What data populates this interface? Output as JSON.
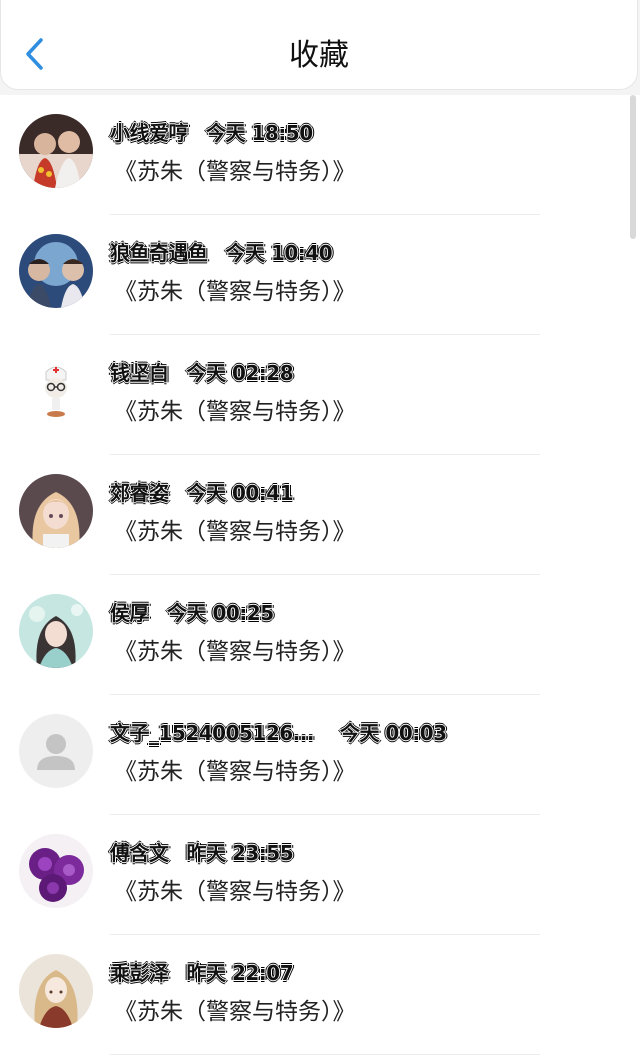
{
  "header": {
    "title": "收藏",
    "back_icon": "chevron-left-icon",
    "accent_color": "#2f8ee0"
  },
  "favorites": [
    {
      "user": "小线爱哼",
      "time": "今天 18:50",
      "book": "《苏朱（警察与特务）》",
      "avatar": "photo-avatar"
    },
    {
      "user": "狼鱼奇遇鱼",
      "time": "今天 10:40",
      "book": "《苏朱（警察与特务）》",
      "avatar": "photo-avatar"
    },
    {
      "user": "钱坚白",
      "time": "今天 02:28",
      "book": "《苏朱（警察与特务）》",
      "avatar": "doctor-bust-avatar"
    },
    {
      "user": "郊睿姿",
      "time": "今天 00:41",
      "book": "《苏朱（警察与特务）》",
      "avatar": "anime-avatar"
    },
    {
      "user": "侯厚",
      "time": "今天 00:25",
      "book": "《苏朱（警察与特务）》",
      "avatar": "photo-avatar"
    },
    {
      "user": "文子_1524005126...",
      "time": "今天 00:03",
      "book": "《苏朱（警察与特务）》",
      "avatar": "default-user-icon"
    },
    {
      "user": "傅含文",
      "time": "昨天 23:55",
      "book": "《苏朱（警察与特务）》",
      "avatar": "purple-roses-avatar"
    },
    {
      "user": "乘彭泽",
      "time": "昨天 22:07",
      "book": "《苏朱（警察与特务）》",
      "avatar": "illustration-avatar"
    }
  ]
}
